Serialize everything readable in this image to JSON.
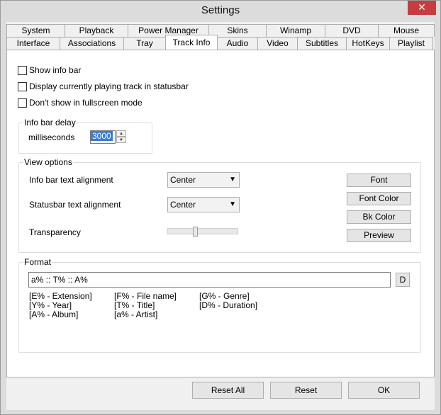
{
  "window": {
    "title": "Settings",
    "close_glyph": "✕"
  },
  "tabs_row1": [
    "System",
    "Playback",
    "Power Manager",
    "Skins",
    "Winamp",
    "DVD",
    "Mouse"
  ],
  "tabs_row2": [
    "Interface",
    "Associations",
    "Tray",
    "Track Info",
    "Audio",
    "Video",
    "Subtitles",
    "HotKeys",
    "Playlist"
  ],
  "active_tab": "Track Info",
  "checkboxes": [
    {
      "label": "Show info bar",
      "checked": false
    },
    {
      "label": "Display currently playing track in statusbar",
      "checked": false
    },
    {
      "label": "Don't show in fullscreen mode",
      "checked": false
    }
  ],
  "info_bar_delay": {
    "title": "Info bar delay",
    "label": "milliseconds",
    "value": "3000"
  },
  "view_options": {
    "title": "View options",
    "info_align_label": "Info bar text alignment",
    "info_align_value": "Center",
    "status_align_label": "Statusbar text alignment",
    "status_align_value": "Center",
    "transparency_label": "Transparency",
    "transparency_level": 0.4,
    "buttons": [
      "Font",
      "Font Color",
      "Bk Color",
      "Preview"
    ]
  },
  "format": {
    "title": "Format",
    "value": "a% :: T% :: A%",
    "default_button": "D",
    "legend": [
      "[E% - Extension]",
      "[F% - File name]",
      "[G% - Genre]",
      "[Y% - Year]",
      "[T% - Title]",
      "[D% - Duration]",
      "[A% - Album]",
      "[a% - Artist]"
    ]
  },
  "footer": {
    "reset_all": "Reset All",
    "reset": "Reset",
    "ok": "OK"
  }
}
